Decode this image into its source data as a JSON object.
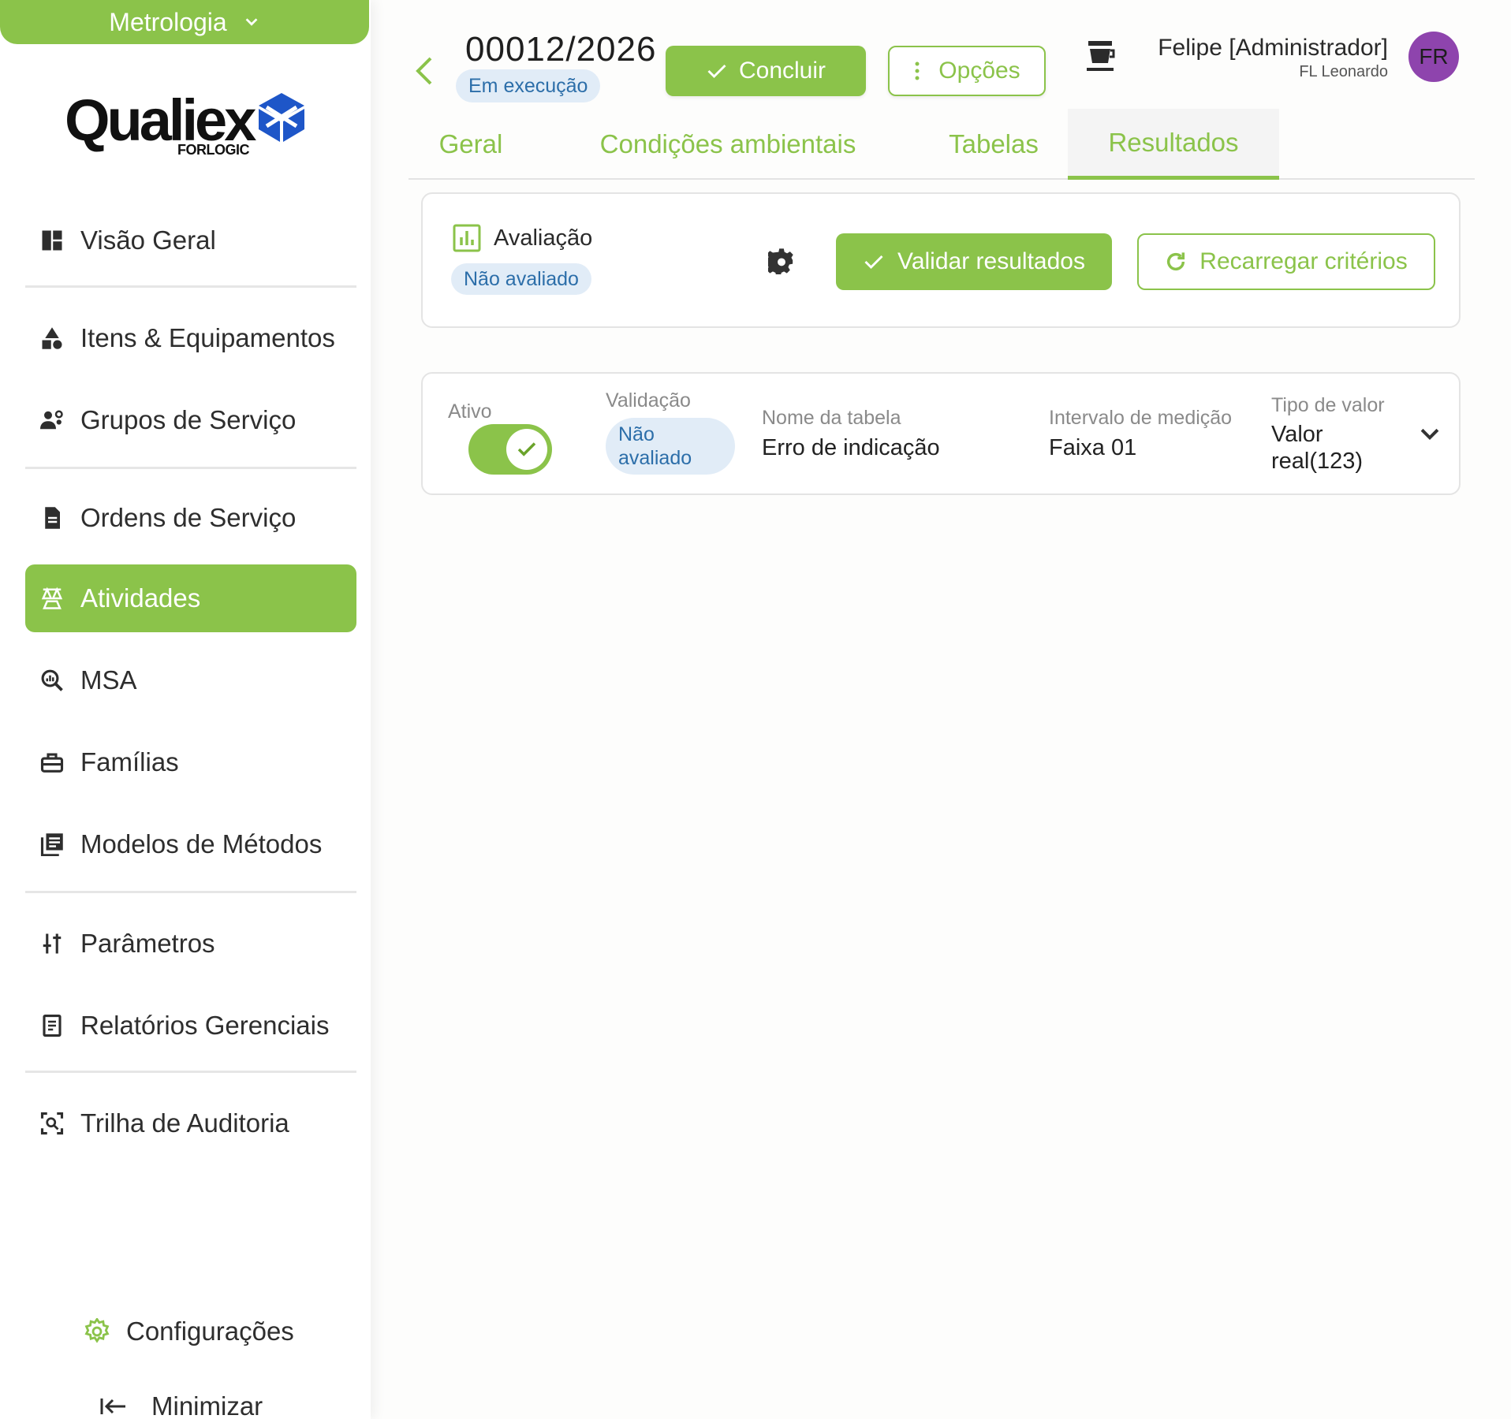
{
  "sidebar": {
    "module_label": "Metrologia",
    "logo": {
      "word": "Qualiex",
      "sub": "FORLOGIC"
    },
    "items": [
      {
        "label": "Visão Geral",
        "icon": "dashboard-icon"
      },
      {
        "label": "Itens & Equipamentos",
        "icon": "shapes-icon"
      },
      {
        "label": "Grupos de Serviço",
        "icon": "group-gear-icon"
      },
      {
        "label": "Ordens de Serviço",
        "icon": "document-icon"
      },
      {
        "label": "Atividades",
        "icon": "scale-icon",
        "active": true
      },
      {
        "label": "MSA",
        "icon": "search-chart-icon"
      },
      {
        "label": "Famílias",
        "icon": "toolbox-icon"
      },
      {
        "label": "Modelos de Métodos",
        "icon": "library-icon"
      },
      {
        "label": "Parâmetros",
        "icon": "sliders-icon"
      },
      {
        "label": "Relatórios Gerenciais",
        "icon": "report-icon"
      },
      {
        "label": "Trilha de Auditoria",
        "icon": "scan-icon"
      }
    ],
    "config_label": "Configurações",
    "minimize_label": "Minimizar"
  },
  "header": {
    "order_number": "00012/2026",
    "status": "Em execução",
    "conclude_label": "Concluir",
    "options_label": "Opções",
    "user_name": "Felipe [Administrador]",
    "user_sub": "FL Leonardo",
    "avatar_initials": "FR"
  },
  "tabs": [
    {
      "label": "Geral"
    },
    {
      "label": "Condições ambientais"
    },
    {
      "label": "Tabelas"
    },
    {
      "label": "Resultados",
      "active": true
    }
  ],
  "evaluation": {
    "title": "Avaliação",
    "status": "Não avaliado",
    "validate_label": "Validar resultados",
    "reload_label": "Recarregar critérios"
  },
  "result_row": {
    "active_label": "Ativo",
    "active": true,
    "validation_label": "Validação",
    "validation_value": "Não avaliado",
    "table_name_label": "Nome da tabela",
    "table_name": "Erro de indicação",
    "interval_label": "Intervalo de medição",
    "interval": "Faixa 01",
    "value_type_label": "Tipo de valor",
    "value_type": "Valor real(123)"
  },
  "colors": {
    "accent": "#8bc34a",
    "chip_bg": "#e1ecf7",
    "chip_text": "#2c6ea9",
    "avatar": "#8e44ad"
  }
}
